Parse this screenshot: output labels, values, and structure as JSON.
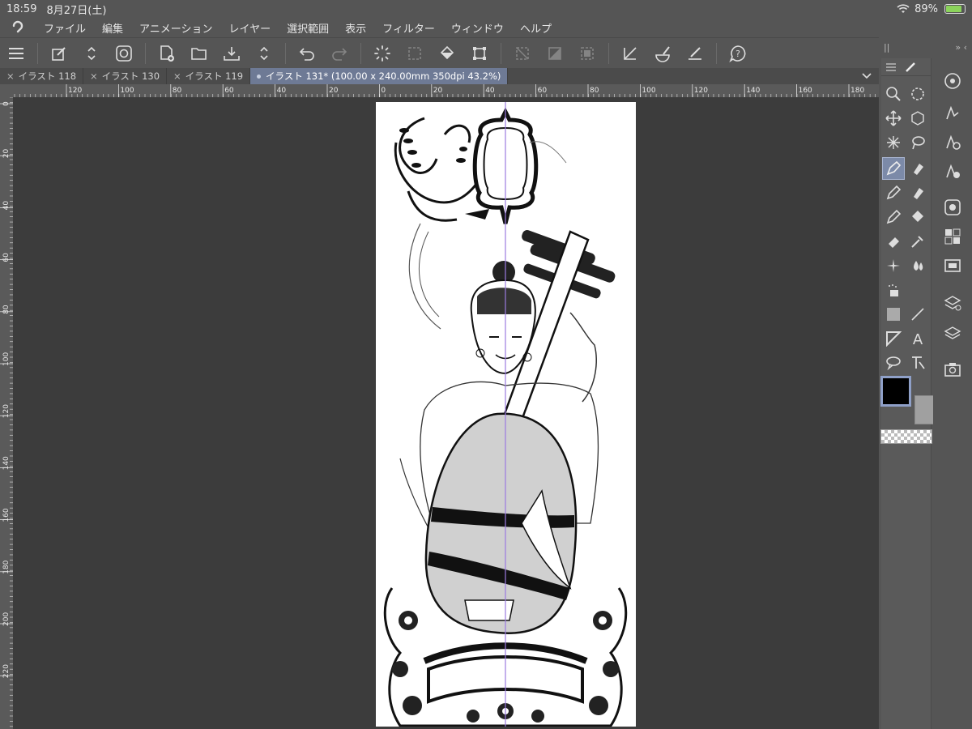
{
  "status": {
    "time": "18:59",
    "date": "8月27日(土)",
    "battery": "89%",
    "battery_level": 0.89
  },
  "menu": [
    "ファイル",
    "編集",
    "アニメーション",
    "レイヤー",
    "選択範囲",
    "表示",
    "フィルター",
    "ウィンドウ",
    "ヘルプ"
  ],
  "tabs": [
    "イラスト 118",
    "イラスト 130",
    "イラスト 119"
  ],
  "active_tab": "イラスト 131* (100.00 x 240.00mm 350dpi 43.2%)",
  "hruler_labels": [
    "120",
    "100",
    "80",
    "60",
    "40",
    "20",
    "0",
    "20",
    "40",
    "60",
    "80",
    "100",
    "120",
    "140",
    "160",
    "180"
  ],
  "vruler_labels": [
    "0",
    "20",
    "40",
    "60",
    "80",
    "100",
    "120",
    "140",
    "160",
    "180",
    "200",
    "220"
  ],
  "colors": {
    "main": "#000000",
    "sub": "#a0a0a0",
    "accent": "#7c8aa8"
  },
  "toolbar_icons": [
    "menu-icon",
    "edit-icon",
    "stepper-icon",
    "clip-studio-icon",
    "new-canvas-icon",
    "open-folder-icon",
    "save-icon",
    "stepper-icon",
    "undo-icon",
    "redo-icon",
    "loading-icon",
    "select-icon",
    "fill-icon",
    "transform-icon",
    "deselect-icon",
    "invert-selection-icon",
    "hide-selection-icon",
    "ruler-icon",
    "brush-ruler-icon",
    "pen-ruler-icon",
    "help-icon"
  ]
}
